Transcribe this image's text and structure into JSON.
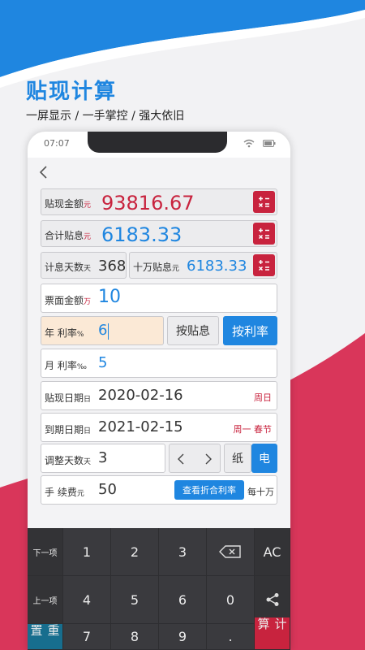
{
  "promo": {
    "headline": "贴现计算",
    "subline": "一屏显示 / 一手掌控 / 强大依旧"
  },
  "status": {
    "time": "07:07"
  },
  "results": {
    "discount_amount": {
      "label": "贴现金额",
      "unit": "元",
      "value": "93816.67"
    },
    "total_interest": {
      "label": "合计贴息",
      "unit": "元",
      "value": "6183.33"
    },
    "interest_days": {
      "label": "计息天数",
      "unit": "天",
      "value": "368"
    },
    "per_100k": {
      "label": "十万贴息",
      "unit": "元",
      "value": "6183.33"
    }
  },
  "inputs": {
    "face_amount": {
      "label": "票面金额",
      "unit": "万",
      "value": "10"
    },
    "annual_rate": {
      "label": "年 利率",
      "unit": "%",
      "value": "6"
    },
    "monthly_rate": {
      "label": "月 利率",
      "unit": "‰",
      "value": "5"
    },
    "discount_date": {
      "label": "贴现日期",
      "unit": "日",
      "value": "2020-02-16",
      "note": "周日"
    },
    "due_date": {
      "label": "到期日期",
      "unit": "日",
      "value": "2021-02-15",
      "note": "周一 春节"
    },
    "adjust_days": {
      "label": "调整天数",
      "unit": "天",
      "value": "3"
    },
    "fee": {
      "label": "手 续费",
      "unit": "元",
      "value": "50",
      "note": "每十万"
    }
  },
  "buttons": {
    "by_interest": "按贴息",
    "by_rate": "按利率",
    "paper": "纸",
    "electronic": "电",
    "view_rate": "查看折合利率"
  },
  "keypad": {
    "next": "下一项",
    "prev": "上一项",
    "reset": "重置",
    "calc": "计算",
    "ac": "AC",
    "keys": [
      "1",
      "2",
      "3",
      "4",
      "5",
      "6",
      "0",
      "7",
      "8",
      "9",
      "."
    ]
  },
  "colors": {
    "accent_blue": "#1f86e0",
    "accent_red": "#c8233e",
    "rate_highlight": "#fbe9d6"
  }
}
